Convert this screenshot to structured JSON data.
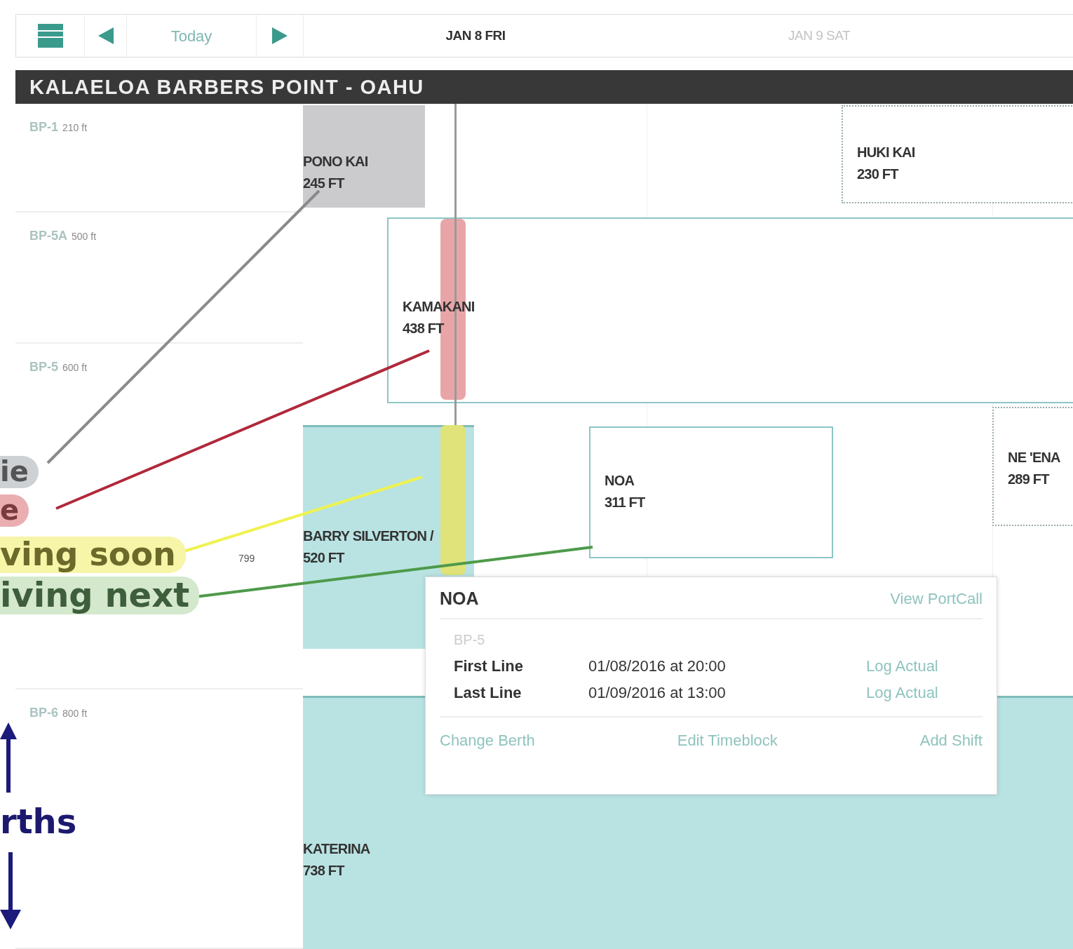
{
  "toolbar": {
    "today": "Today",
    "dates": [
      {
        "label": "JAN 8 FRI",
        "selected": true
      },
      {
        "label": "JAN 9 SAT",
        "selected": false
      }
    ]
  },
  "port": {
    "title": "KALAELOA BARBERS POINT - OAHU"
  },
  "berths": [
    {
      "name": "BP-1",
      "length": "210 ft"
    },
    {
      "name": "BP-5A",
      "length": "500 ft"
    },
    {
      "name": "BP-5",
      "length": "600 ft"
    },
    {
      "name": "BP-6",
      "length": "800 ft"
    }
  ],
  "vessels": [
    {
      "name": "PONO KAI",
      "length": "245 FT",
      "kind": "departed"
    },
    {
      "name": "HUKI KAI",
      "length": "230 FT",
      "kind": "planned"
    },
    {
      "name": "KAMAKANI",
      "length": "438 FT",
      "kind": "scheduled",
      "marker": {
        "color": "#e8a5a8"
      }
    },
    {
      "name": "BARRY SILVERTON /",
      "length": "520 FT",
      "kind": "berthed",
      "tick_label": "799",
      "marker": {
        "color": "#dfe37a"
      }
    },
    {
      "name": "NOA",
      "length": "311 FT",
      "kind": "scheduled"
    },
    {
      "name": "NE 'ENA",
      "length": "289 FT",
      "kind": "planned"
    },
    {
      "name": "KATERINA",
      "length": "738 FT",
      "kind": "berthed"
    }
  ],
  "popover": {
    "title": "NOA",
    "link": "View PortCall",
    "berth": "BP-5",
    "rows": [
      {
        "label": "First Line",
        "value": "01/08/2016 at 20:00",
        "action": "Log Actual"
      },
      {
        "label": "Last Line",
        "value": "01/09/2016 at 13:00",
        "action": "Log Actual"
      }
    ],
    "actions": [
      "Change Berth",
      "Edit Timeblock",
      "Add Shift"
    ]
  },
  "annotations": [
    {
      "text": "ie",
      "color": "#cdd1d3"
    },
    {
      "text": "e",
      "color": "#eaaeb1"
    },
    {
      "text": "ving soon",
      "color": "#f6f5a8"
    },
    {
      "text": "iving next",
      "color": "#d3e8cc"
    },
    {
      "text": "rths"
    }
  ]
}
